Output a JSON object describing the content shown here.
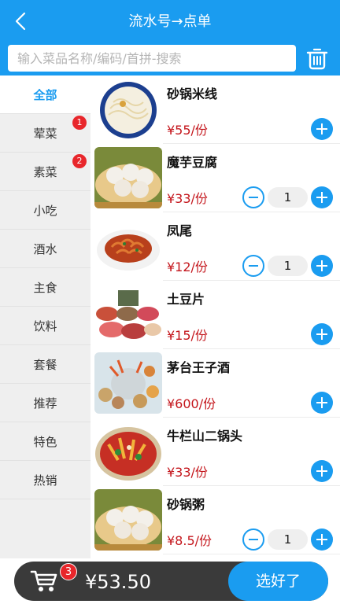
{
  "header": {
    "title": "流水号→点单"
  },
  "search": {
    "placeholder": "输入菜品名称/编码/首拼-搜索"
  },
  "sidebar": {
    "items": [
      {
        "label": "全部",
        "active": true,
        "badge": ""
      },
      {
        "label": "荤菜",
        "active": false,
        "badge": "1"
      },
      {
        "label": "素菜",
        "active": false,
        "badge": "2"
      },
      {
        "label": "小吃",
        "active": false,
        "badge": ""
      },
      {
        "label": "酒水",
        "active": false,
        "badge": ""
      },
      {
        "label": "主食",
        "active": false,
        "badge": ""
      },
      {
        "label": "饮料",
        "active": false,
        "badge": ""
      },
      {
        "label": "套餐",
        "active": false,
        "badge": ""
      },
      {
        "label": "推荐",
        "active": false,
        "badge": ""
      },
      {
        "label": "特色",
        "active": false,
        "badge": ""
      },
      {
        "label": "热销",
        "active": false,
        "badge": ""
      }
    ]
  },
  "dishes": [
    {
      "name": "砂锅米线",
      "price": "¥55/份",
      "qty": ""
    },
    {
      "name": "魔芋豆腐",
      "price": "¥33/份",
      "qty": "1"
    },
    {
      "name": "凤尾",
      "price": "¥12/份",
      "qty": "1"
    },
    {
      "name": "土豆片",
      "price": "¥15/份",
      "qty": ""
    },
    {
      "name": "茅台王子酒",
      "price": "¥600/份",
      "qty": ""
    },
    {
      "name": "牛栏山二锅头",
      "price": "¥33/份",
      "qty": ""
    },
    {
      "name": "砂锅粥",
      "price": "¥8.5/份",
      "qty": "1"
    }
  ],
  "cart": {
    "count": "3",
    "total": "¥53.50",
    "checkout_label": "选好了"
  },
  "colors": {
    "accent": "#1a9cf0",
    "price": "#c4161c",
    "badge": "#e8262b",
    "cart_bar": "#3a3a3a"
  }
}
